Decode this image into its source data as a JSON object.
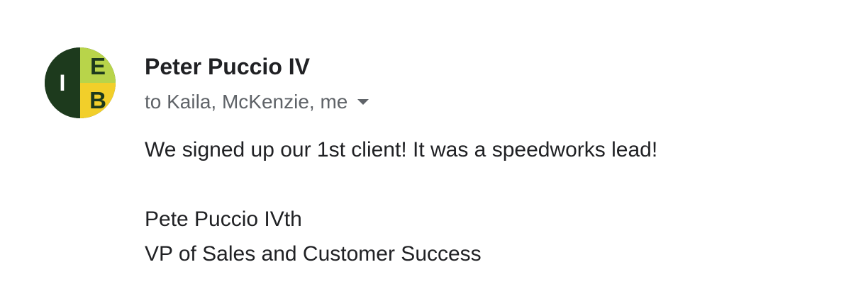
{
  "sender": {
    "avatar": {
      "letters": [
        "I",
        "E",
        "B"
      ],
      "colors": {
        "dark_green": "#1d3a1d",
        "lime": "#b8d44a",
        "yellow": "#f2cf2a"
      }
    },
    "name": "Peter Puccio IV",
    "recipients": "to Kaila, McKenzie, me",
    "recipients_toggle_icon": "caret-down-icon"
  },
  "message": {
    "body": "We signed up our 1st client! It was a speedworks lead!",
    "signature": {
      "name": "Pete Puccio IVth",
      "title": "VP of Sales and Customer Success"
    }
  }
}
